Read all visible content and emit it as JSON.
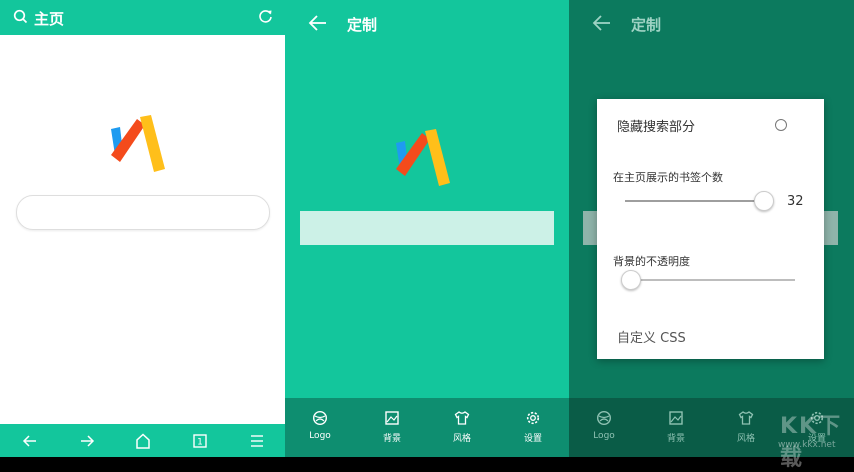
{
  "home": {
    "title": "主页",
    "icons": {
      "search": "search-icon",
      "refresh": "refresh-icon"
    },
    "nav": [
      {
        "name": "back-icon"
      },
      {
        "name": "forward-icon"
      },
      {
        "name": "home-icon"
      },
      {
        "name": "tabs-icon",
        "count": "1"
      },
      {
        "name": "menu-icon"
      }
    ]
  },
  "customize": {
    "title": "定制",
    "tabs": [
      {
        "label": "Logo",
        "icon": "logo-icon"
      },
      {
        "label": "背景",
        "icon": "image-icon"
      },
      {
        "label": "风格",
        "icon": "tshirt-icon"
      },
      {
        "label": "设置",
        "icon": "gear-icon"
      }
    ]
  },
  "settings_dialog": {
    "hide_search_label": "隐藏搜索部分",
    "bookmark_count_label": "在主页展示的书签个数",
    "bookmark_count_value": "32",
    "bookmark_count_fraction": 1.0,
    "bg_opacity_label": "背景的不透明度",
    "bg_opacity_fraction": 0.0,
    "custom_css_label": "自定义 CSS"
  },
  "watermark": {
    "main": "KK下载",
    "site": "www.kkx.net"
  },
  "colors": {
    "accent": "#13c69c",
    "accent_dark": "#0c7a5e",
    "tabbar": "#0e8e70"
  }
}
